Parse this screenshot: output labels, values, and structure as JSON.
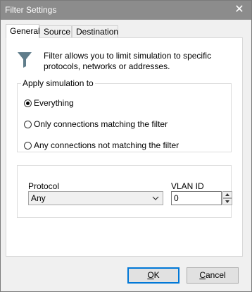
{
  "window": {
    "title": "Filter Settings",
    "close_glyph": "✕"
  },
  "tabs": [
    {
      "label": "General",
      "active": true
    },
    {
      "label": "Source",
      "active": false
    },
    {
      "label": "Destination",
      "active": false
    }
  ],
  "general": {
    "icon": "funnel-icon",
    "description": "Filter allows you to limit simulation to specific protocols, networks or addresses.",
    "apply_group": {
      "legend": "Apply simulation to",
      "options": [
        {
          "label": "Everything",
          "checked": true
        },
        {
          "label": "Only connections matching the filter",
          "checked": false
        },
        {
          "label": "Any connections not matching the filter",
          "checked": false
        }
      ]
    },
    "protocol": {
      "label": "Protocol",
      "value": "Any"
    },
    "vlan": {
      "label": "VLAN ID",
      "value": "0"
    }
  },
  "buttons": {
    "ok": {
      "accel": "O",
      "rest": "K"
    },
    "cancel": {
      "accel": "C",
      "rest": "ancel"
    }
  },
  "colors": {
    "titlebar": "#8c8c8c",
    "focus_border": "#0078d7",
    "funnel": "#607d8b"
  }
}
